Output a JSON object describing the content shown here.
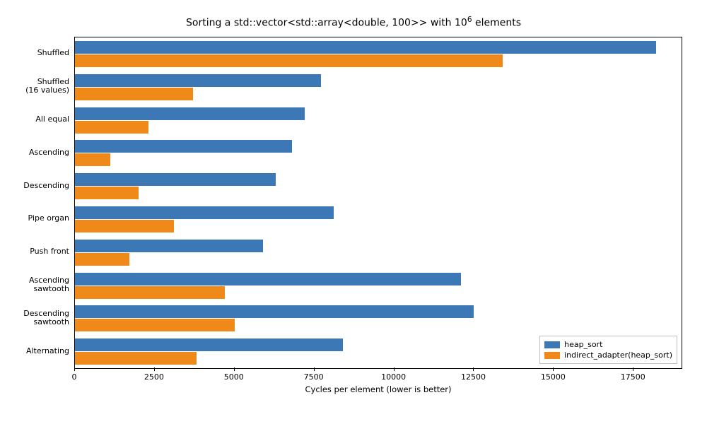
{
  "chart_data": {
    "type": "bar",
    "orientation": "horizontal",
    "title": "Sorting a std::vector<std::array<double, 100>> with 10^6 elements",
    "xlabel": "Cycles per element (lower is better)",
    "ylabel": "",
    "xlim": [
      0,
      19000
    ],
    "categories": [
      "Shuffled",
      "Shuffled\n(16 values)",
      "All equal",
      "Ascending",
      "Descending",
      "Pipe organ",
      "Push front",
      "Ascending\nsawtooth",
      "Descending\nsawtooth",
      "Alternating"
    ],
    "series": [
      {
        "name": "heap_sort",
        "values": [
          18200,
          7700,
          7200,
          6800,
          6300,
          8100,
          5900,
          12100,
          12500,
          8400
        ]
      },
      {
        "name": "indirect_adapter(heap_sort)",
        "values": [
          13400,
          3700,
          2300,
          1100,
          2000,
          3100,
          1700,
          4700,
          5000,
          3800
        ]
      }
    ],
    "xticks": [
      0,
      2500,
      5000,
      7500,
      10000,
      12500,
      15000,
      17500
    ],
    "colors": {
      "heap_sort": "#3b78b5",
      "indirect_adapter(heap_sort)": "#ef8a1a"
    },
    "legend_position": "lower right"
  }
}
